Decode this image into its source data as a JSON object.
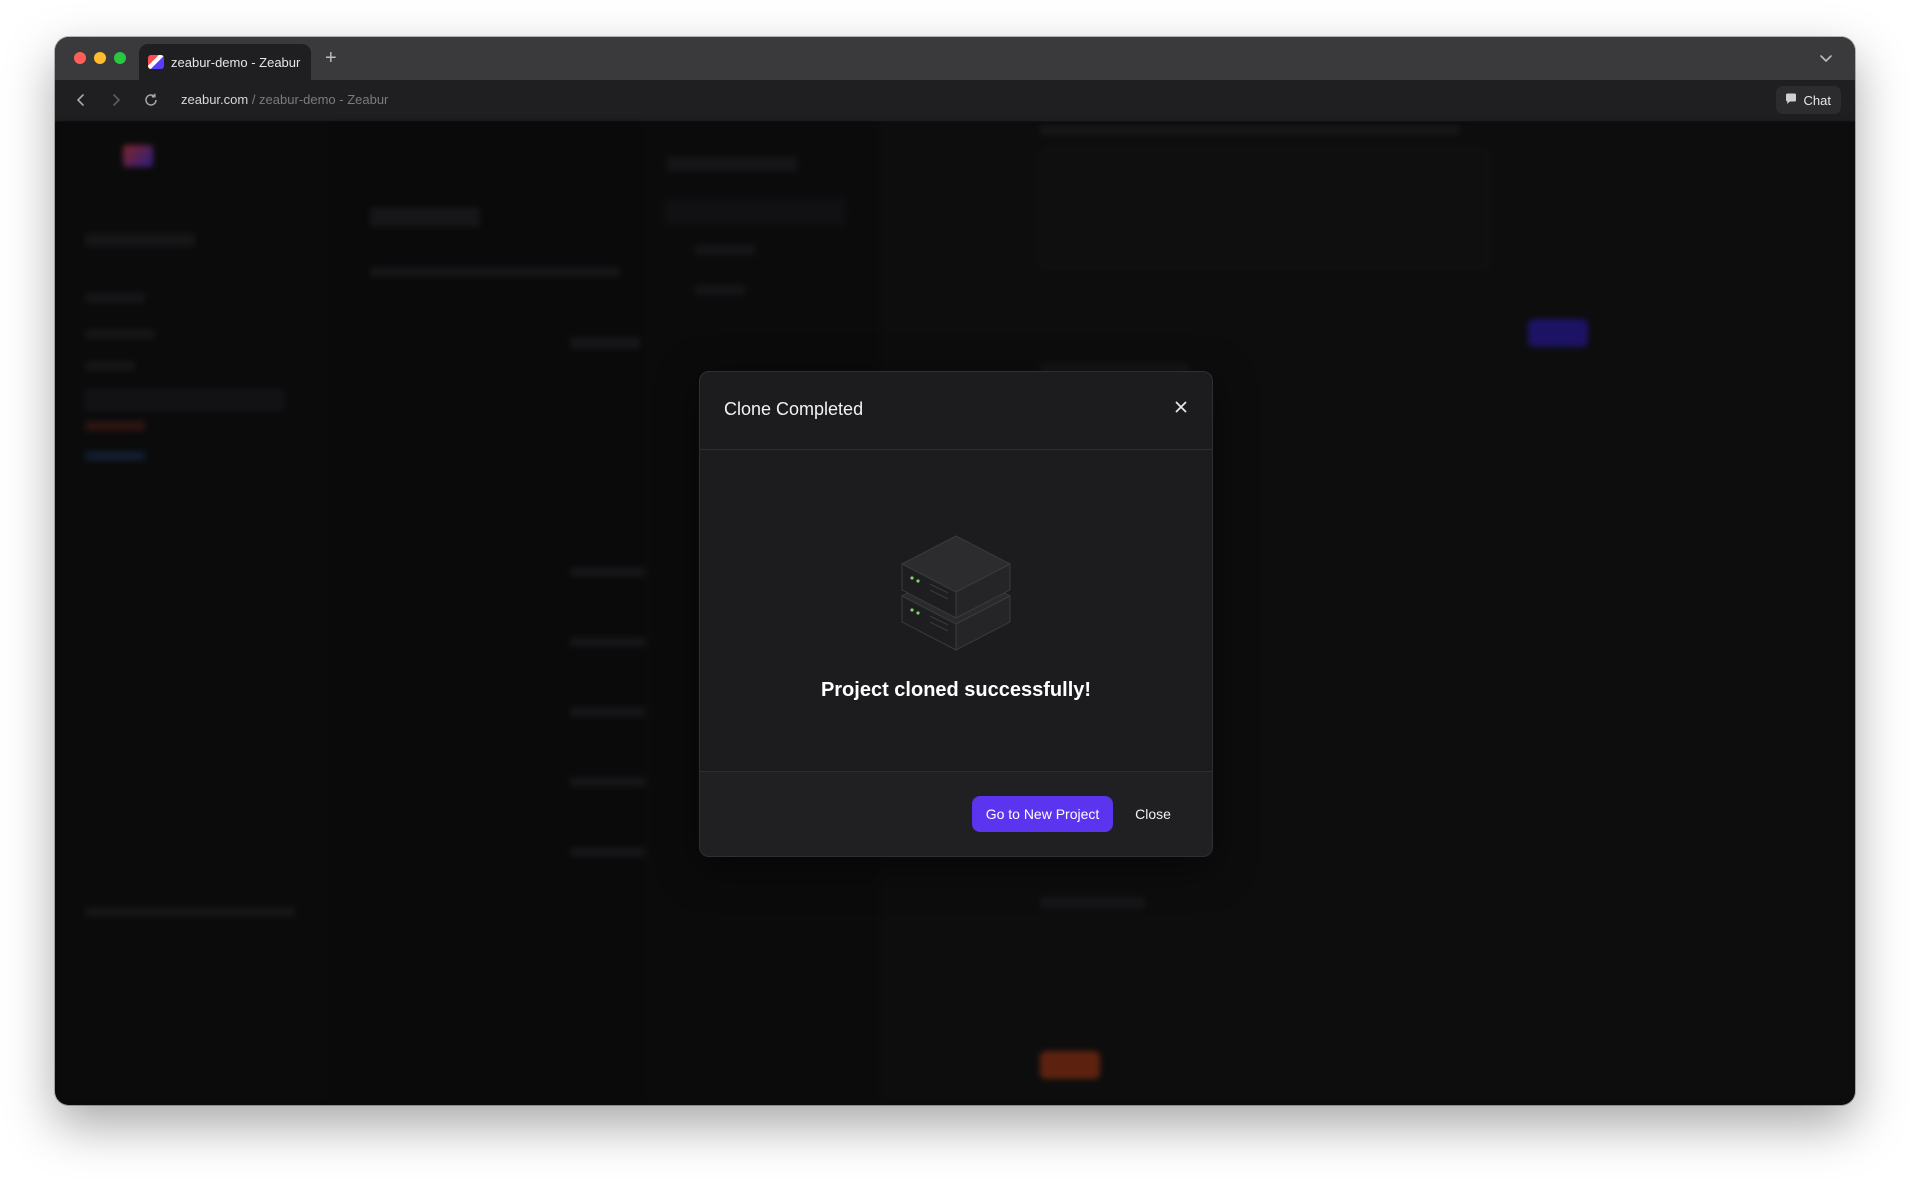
{
  "browser": {
    "tab_title": "zeabur-demo - Zeabur",
    "new_tab_symbol": "+",
    "url_domain": "zeabur.com",
    "url_path": " / zeabur-demo - Zeabur",
    "chat_label": "Chat"
  },
  "modal": {
    "title": "Clone Completed",
    "message": "Project cloned successfully!",
    "primary_button": "Go to New Project",
    "secondary_button": "Close",
    "icon": "server-stack-icon"
  },
  "colors": {
    "accent": "#5b34f0",
    "danger": "#b8451f",
    "modal_bg": "#1c1c1e",
    "backdrop": "#141416"
  }
}
